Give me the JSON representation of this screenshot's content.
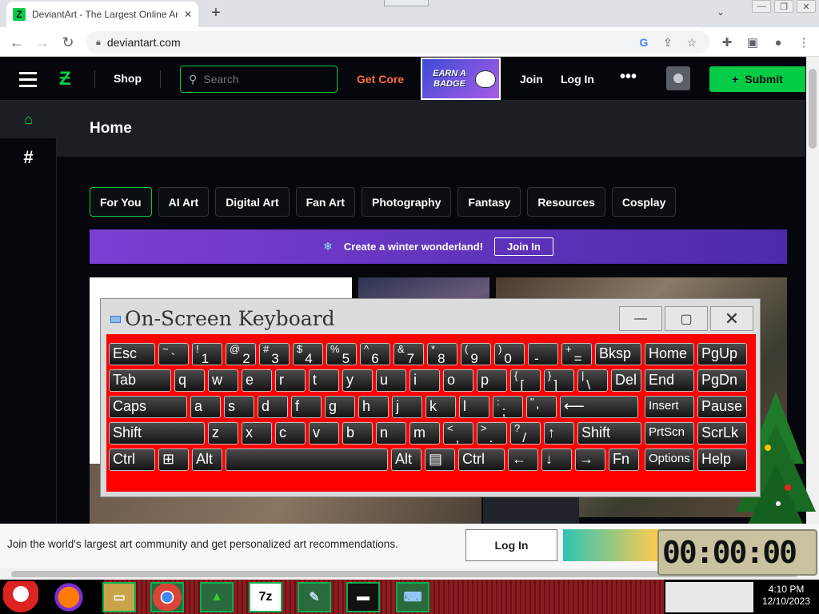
{
  "browser": {
    "tab_title": "DeviantArt - The Largest Online Art Gallery",
    "tab_favicon": "Z",
    "url": "deviantart.com",
    "icons": [
      "back-icon",
      "forward-icon",
      "reload-icon",
      "lock-icon",
      "google-icon",
      "share-icon",
      "star-icon",
      "extensions-icon",
      "sidepanel-icon",
      "profile-icon",
      "menu-icon"
    ]
  },
  "da_header": {
    "shop": "Shop",
    "search_placeholder": "Search",
    "get_core": "Get Core",
    "badge_line1": "EARN A",
    "badge_line2": "BADGE",
    "join": "Join",
    "login": "Log In",
    "more": "•••",
    "submit": "Submit"
  },
  "page": {
    "title": "Home",
    "categories": [
      "For You",
      "AI Art",
      "Digital Art",
      "Fan Art",
      "Photography",
      "Fantasy",
      "Resources",
      "Cosplay"
    ],
    "active_category": "For You",
    "banner_text": "Create a winter wonderland!",
    "banner_button": "Join In"
  },
  "cookie_bar": {
    "text": "Join the world's largest art community and get personalized art recommendations.",
    "button": "Log In"
  },
  "clock_widget": {
    "display": "00:00:00"
  },
  "osk": {
    "title": "On-Screen Keyboard",
    "rows": [
      [
        {
          "main": "Esc"
        },
        {
          "shift": "~",
          "main": "`"
        },
        {
          "shift": "!",
          "main": "1"
        },
        {
          "shift": "@",
          "main": "2"
        },
        {
          "shift": "#",
          "main": "3"
        },
        {
          "shift": "$",
          "main": "4"
        },
        {
          "shift": "%",
          "main": "5"
        },
        {
          "shift": "^",
          "main": "6"
        },
        {
          "shift": "&",
          "main": "7"
        },
        {
          "shift": "*",
          "main": "8"
        },
        {
          "shift": "(",
          "main": "9"
        },
        {
          "shift": ")",
          "main": "0"
        },
        {
          "shift": "",
          "main": "-"
        },
        {
          "shift": "+",
          "main": "="
        },
        {
          "main": "Bksp"
        },
        {
          "main": "Home"
        },
        {
          "main": "PgUp"
        }
      ],
      [
        {
          "main": "Tab"
        },
        {
          "main": "q"
        },
        {
          "main": "w"
        },
        {
          "main": "e"
        },
        {
          "main": "r"
        },
        {
          "main": "t"
        },
        {
          "main": "y"
        },
        {
          "main": "u"
        },
        {
          "main": "i"
        },
        {
          "main": "o"
        },
        {
          "main": "p"
        },
        {
          "shift": "{",
          "main": "["
        },
        {
          "shift": "}",
          "main": "]"
        },
        {
          "shift": "|",
          "main": "\\"
        },
        {
          "main": "Del"
        },
        {
          "main": "End"
        },
        {
          "main": "PgDn"
        }
      ],
      [
        {
          "main": "Caps"
        },
        {
          "main": "a"
        },
        {
          "main": "s"
        },
        {
          "main": "d"
        },
        {
          "main": "f"
        },
        {
          "main": "g"
        },
        {
          "main": "h"
        },
        {
          "main": "j"
        },
        {
          "main": "k"
        },
        {
          "main": "l"
        },
        {
          "shift": ":",
          "main": ";"
        },
        {
          "shift": "\"",
          "main": "'"
        },
        {
          "main": "⟵"
        },
        {
          "main": "Insert"
        },
        {
          "main": "Pause"
        }
      ],
      [
        {
          "main": "Shift"
        },
        {
          "main": "z"
        },
        {
          "main": "x"
        },
        {
          "main": "c"
        },
        {
          "main": "v"
        },
        {
          "main": "b"
        },
        {
          "main": "n"
        },
        {
          "main": "m"
        },
        {
          "shift": "<",
          "main": ","
        },
        {
          "shift": ">",
          "main": "."
        },
        {
          "shift": "?",
          "main": "/"
        },
        {
          "main": "↑"
        },
        {
          "main": "Shift"
        },
        {
          "main": "PrtScn"
        },
        {
          "main": "ScrLk"
        }
      ],
      [
        {
          "main": "Ctrl"
        },
        {
          "main": "⊞"
        },
        {
          "main": "Alt"
        },
        {
          "main": ""
        },
        {
          "main": "Alt"
        },
        {
          "main": "▤"
        },
        {
          "main": "Ctrl"
        },
        {
          "main": "←"
        },
        {
          "main": "↓"
        },
        {
          "main": "→"
        },
        {
          "main": "Fn"
        },
        {
          "main": "Options"
        },
        {
          "main": "Help"
        }
      ]
    ]
  },
  "taskbar": {
    "apps": [
      "santa-icon",
      "firefox-icon",
      "file-explorer-icon",
      "chrome-icon",
      "xmas-tree-icon",
      "7zip-icon",
      "notepad-icon",
      "cmd-icon",
      "osk-icon"
    ],
    "apps_7z_label": "7z",
    "time": "4:10 PM",
    "date": "12/10/2023"
  }
}
